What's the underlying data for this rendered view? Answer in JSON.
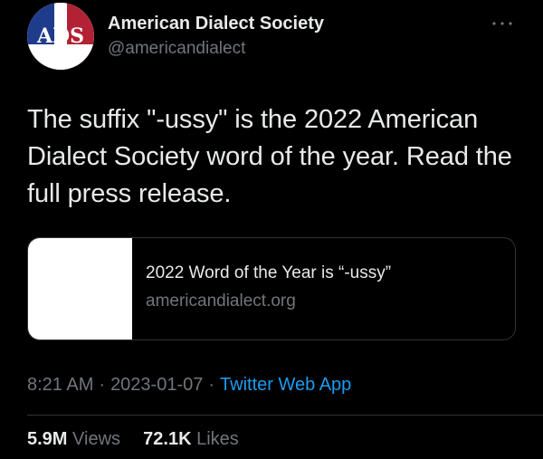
{
  "account": {
    "display_name": "American Dialect Society",
    "handle": "@americandialect",
    "avatar_letters": "ADS"
  },
  "tweet": {
    "text": "The suffix \"-ussy\" is the 2022 American Dialect Society word of the year. Read the full press release."
  },
  "card": {
    "title": "2022 Word of the Year is “-ussy”",
    "domain": "americandialect.org"
  },
  "meta": {
    "time": "8:21 AM",
    "separator": "·",
    "date": "2023-01-07",
    "source": "Twitter Web App"
  },
  "stats": {
    "views_count": "5.9M",
    "views_label": "Views",
    "likes_count": "72.1K",
    "likes_label": "Likes"
  },
  "icons": {
    "more": "more-horizontal-icon"
  },
  "colors": {
    "background": "#000000",
    "text_primary": "#e7e9ea",
    "text_secondary": "#71767b",
    "accent": "#1d9bf0",
    "border": "#2f3336",
    "avatar_blue": "#1f3b8c",
    "avatar_red": "#b22234"
  }
}
